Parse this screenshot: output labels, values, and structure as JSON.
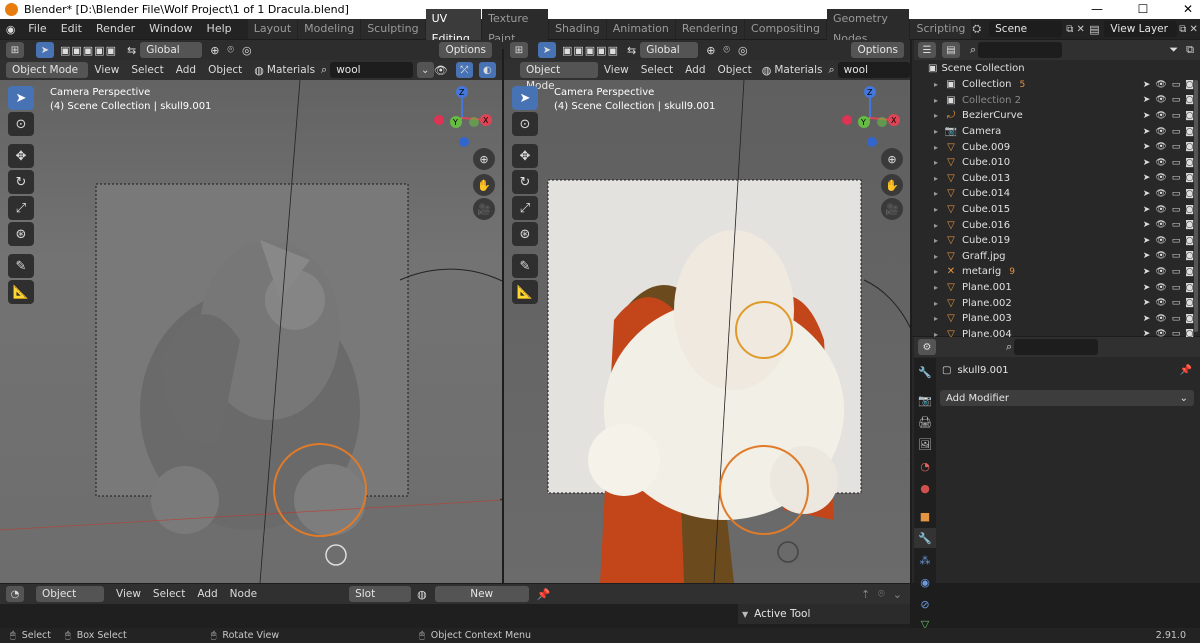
{
  "window": {
    "title": "Blender* [D:\\Blender File\\Wolf Project\\1 of 1 Dracula.blend]",
    "minimize": "—",
    "maximize": "☐",
    "close": "✕"
  },
  "menus": [
    "File",
    "Edit",
    "Render",
    "Window",
    "Help"
  ],
  "workspaces": [
    "Layout",
    "Modeling",
    "Sculpting",
    "UV Editing",
    "Texture Paint",
    "Shading",
    "Animation",
    "Rendering",
    "Compositing",
    "Geometry Nodes",
    "Scripting"
  ],
  "active_workspace": "UV Editing",
  "scene": {
    "name": "Scene",
    "view_layer": "View Layer"
  },
  "viewport_left": {
    "transform": "Global",
    "options": "Options",
    "mode": "Object Mode",
    "menu": [
      "View",
      "Select",
      "Add",
      "Object"
    ],
    "shading": "Materials",
    "search": "wool",
    "overlay_title": "Camera Perspective",
    "overlay_sub": "(4) Scene Collection | skull9.001"
  },
  "viewport_right": {
    "transform": "Global",
    "options": "Options",
    "mode": "Object Mode",
    "menu": [
      "View",
      "Select",
      "Add",
      "Object"
    ],
    "shading": "Materials",
    "search": "wool",
    "overlay_title": "Camera Perspective",
    "overlay_sub": "(4) Scene Collection | skull9.001"
  },
  "gizmo": {
    "x": "X",
    "y": "Y",
    "z": "Z"
  },
  "outliner": {
    "root": "Scene Collection",
    "items": [
      {
        "name": "Collection",
        "icon": "collection-icon",
        "badge": "5"
      },
      {
        "name": "Collection 2",
        "icon": "collection-icon",
        "badge": ""
      },
      {
        "name": "BezierCurve",
        "icon": "curve-icon",
        "badge": ""
      },
      {
        "name": "Camera",
        "icon": "camera-icon",
        "badge": ""
      },
      {
        "name": "Cube.009",
        "icon": "mesh-icon",
        "badge": ""
      },
      {
        "name": "Cube.010",
        "icon": "mesh-icon",
        "badge": ""
      },
      {
        "name": "Cube.013",
        "icon": "mesh-icon",
        "badge": ""
      },
      {
        "name": "Cube.014",
        "icon": "mesh-icon",
        "badge": ""
      },
      {
        "name": "Cube.015",
        "icon": "mesh-icon",
        "badge": ""
      },
      {
        "name": "Cube.016",
        "icon": "mesh-icon",
        "badge": ""
      },
      {
        "name": "Cube.019",
        "icon": "mesh-icon",
        "badge": ""
      },
      {
        "name": "Graff.jpg",
        "icon": "image-icon",
        "badge": ""
      },
      {
        "name": "metarig",
        "icon": "armature-icon",
        "badge": "9"
      },
      {
        "name": "Plane.001",
        "icon": "mesh-icon",
        "badge": ""
      },
      {
        "name": "Plane.002",
        "icon": "mesh-icon",
        "badge": ""
      },
      {
        "name": "Plane.003",
        "icon": "mesh-icon",
        "badge": ""
      },
      {
        "name": "Plane.004",
        "icon": "mesh-icon",
        "badge": ""
      }
    ]
  },
  "properties": {
    "object_name": "skull9.001",
    "add_modifier": "Add Modifier"
  },
  "node_editor": {
    "type": "Object",
    "menu": [
      "View",
      "Select",
      "Add",
      "Node"
    ],
    "slot": "Slot",
    "new": "New",
    "active_tool": "Active Tool"
  },
  "statusbar": {
    "select": "Select",
    "box_select": "Box Select",
    "rotate_view": "Rotate View",
    "context_menu": "Object Context Menu",
    "version": "2.91.0"
  }
}
